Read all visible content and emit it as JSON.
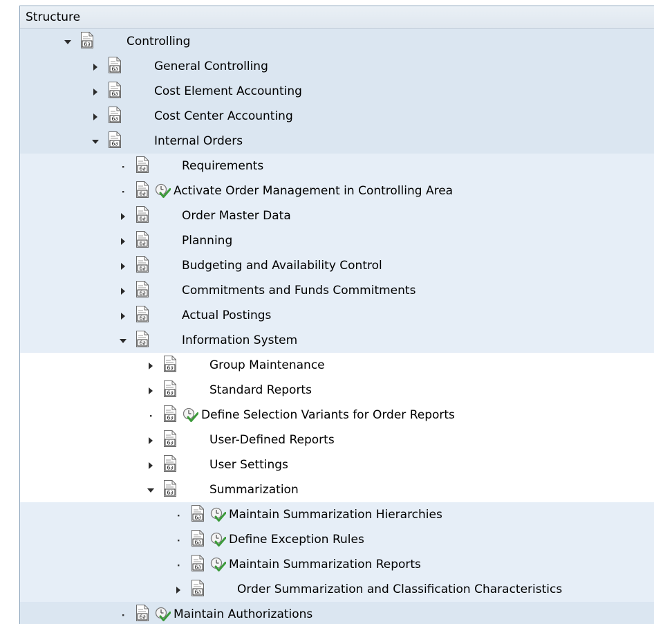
{
  "header": {
    "title": "Structure"
  },
  "colors": {
    "band_dark": "#dbe6f1",
    "band_light": "#e6eef7",
    "white": "#ffffff",
    "border": "#8ea6bd",
    "exec_green": "#3c9a3a"
  },
  "tree": [
    {
      "label": "Controlling",
      "level": 1,
      "state": "expanded",
      "activity": false,
      "band": "dark"
    },
    {
      "label": "General Controlling",
      "level": 2,
      "state": "collapsed",
      "activity": false,
      "band": "dark"
    },
    {
      "label": "Cost Element Accounting",
      "level": 2,
      "state": "collapsed",
      "activity": false,
      "band": "dark"
    },
    {
      "label": "Cost Center Accounting",
      "level": 2,
      "state": "collapsed",
      "activity": false,
      "band": "dark"
    },
    {
      "label": "Internal Orders",
      "level": 2,
      "state": "expanded",
      "activity": false,
      "band": "dark"
    },
    {
      "label": "Requirements",
      "level": 3,
      "state": "leaf",
      "activity": false,
      "band": "light"
    },
    {
      "label": "Activate Order Management in Controlling Area",
      "level": 3,
      "state": "leaf",
      "activity": true,
      "band": "light"
    },
    {
      "label": "Order Master Data",
      "level": 3,
      "state": "collapsed",
      "activity": false,
      "band": "light"
    },
    {
      "label": "Planning",
      "level": 3,
      "state": "collapsed",
      "activity": false,
      "band": "light"
    },
    {
      "label": "Budgeting and Availability Control",
      "level": 3,
      "state": "collapsed",
      "activity": false,
      "band": "light"
    },
    {
      "label": "Commitments and Funds Commitments",
      "level": 3,
      "state": "collapsed",
      "activity": false,
      "band": "light"
    },
    {
      "label": "Actual Postings",
      "level": 3,
      "state": "collapsed",
      "activity": false,
      "band": "light"
    },
    {
      "label": "Information System",
      "level": 3,
      "state": "expanded",
      "activity": false,
      "band": "light"
    },
    {
      "label": "Group Maintenance",
      "level": 4,
      "state": "collapsed",
      "activity": false,
      "band": "white"
    },
    {
      "label": "Standard Reports",
      "level": 4,
      "state": "collapsed",
      "activity": false,
      "band": "white"
    },
    {
      "label": "Define Selection Variants for Order Reports",
      "level": 4,
      "state": "leaf",
      "activity": true,
      "band": "white"
    },
    {
      "label": "User-Defined Reports",
      "level": 4,
      "state": "collapsed",
      "activity": false,
      "band": "white"
    },
    {
      "label": "User Settings",
      "level": 4,
      "state": "collapsed",
      "activity": false,
      "band": "white"
    },
    {
      "label": "Summarization",
      "level": 4,
      "state": "expanded",
      "activity": false,
      "band": "white"
    },
    {
      "label": "Maintain Summarization Hierarchies",
      "level": 5,
      "state": "leaf",
      "activity": true,
      "band": "light"
    },
    {
      "label": "Define Exception Rules",
      "level": 5,
      "state": "leaf",
      "activity": true,
      "band": "light"
    },
    {
      "label": "Maintain Summarization Reports",
      "level": 5,
      "state": "leaf",
      "activity": true,
      "band": "light"
    },
    {
      "label": "Order Summarization and Classification Characteristics",
      "level": 5,
      "state": "collapsed",
      "activity": false,
      "band": "light"
    },
    {
      "label": "Maintain Authorizations",
      "level": 3,
      "state": "leaf",
      "activity": true,
      "band": "dark"
    }
  ]
}
